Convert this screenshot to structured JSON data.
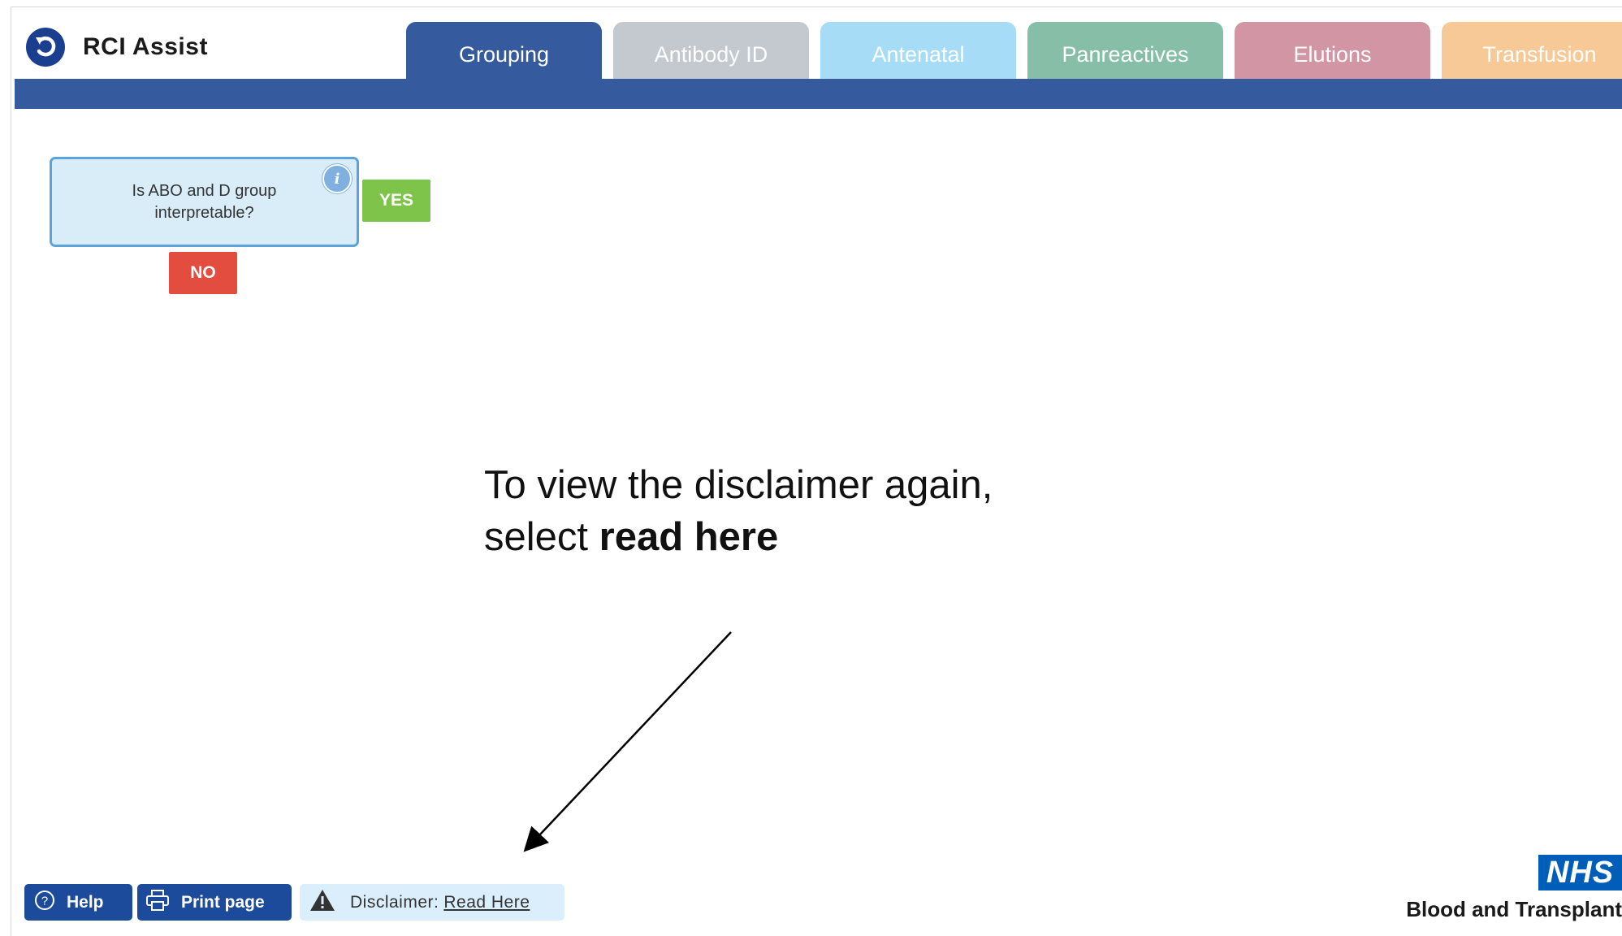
{
  "app": {
    "title": "RCI Assist",
    "logo_icon": "refresh-back-icon"
  },
  "tabs": [
    {
      "label": "Grouping",
      "color": "#355a9e",
      "active": true
    },
    {
      "label": "Antibody ID",
      "color": "#c4c9cf",
      "active": false
    },
    {
      "label": "Antenatal",
      "color": "#a6dcf5",
      "active": false
    },
    {
      "label": "Panreactives",
      "color": "#86bea8",
      "active": false
    },
    {
      "label": "Elutions",
      "color": "#d195a4",
      "active": false
    },
    {
      "label": "Transfusion",
      "color": "#f7c996",
      "active": false
    }
  ],
  "flowchart": {
    "question": "Is ABO and D group interpretable?",
    "info_icon": "info-icon",
    "yes_label": "YES",
    "no_label": "NO",
    "yes_color": "#7ec34a",
    "no_color": "#e24d3f"
  },
  "callout": {
    "line1": "To view the disclaimer again,",
    "line2_prefix": "select ",
    "line2_bold": "read here"
  },
  "footer": {
    "help_label": "Help",
    "help_icon": "question-circle-icon",
    "print_label": "Print page",
    "print_icon": "printer-icon",
    "disclaimer_label": "Disclaimer:",
    "disclaimer_link": "Read Here",
    "disclaimer_icon": "warning-triangle-icon"
  },
  "branding": {
    "nhs": "NHS",
    "org": "Blood and Transplant",
    "nhs_color": "#005eb8"
  }
}
